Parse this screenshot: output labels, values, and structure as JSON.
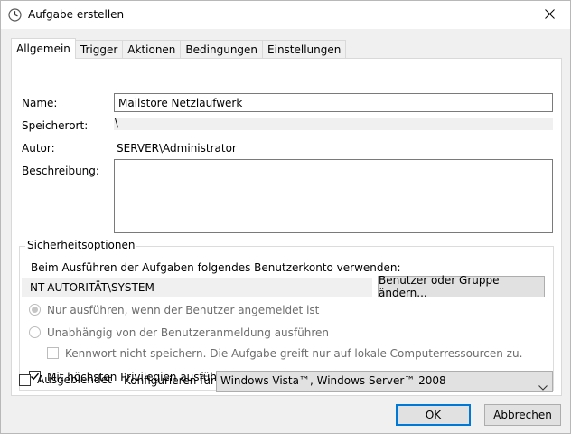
{
  "window": {
    "title": "Aufgabe erstellen"
  },
  "tabs": [
    {
      "label": "Allgemein",
      "active": true
    },
    {
      "label": "Trigger",
      "active": false
    },
    {
      "label": "Aktionen",
      "active": false
    },
    {
      "label": "Bedingungen",
      "active": false
    },
    {
      "label": "Einstellungen",
      "active": false
    }
  ],
  "general": {
    "name_label": "Name:",
    "name_value": "Mailstore Netzlaufwerk",
    "location_label": "Speicherort:",
    "location_value": "\\",
    "author_label": "Autor:",
    "author_value": "SERVER\\Administrator",
    "description_label": "Beschreibung:",
    "description_value": ""
  },
  "security": {
    "group_title": "Sicherheitsoptionen",
    "account_prompt": "Beim Ausführen der Aufgaben folgendes Benutzerkonto verwenden:",
    "account_value": "NT-AUTORITÄT\\SYSTEM",
    "change_button": "Benutzer oder Gruppe ändern...",
    "radio_logged_on": "Nur ausführen, wenn der Benutzer angemeldet ist",
    "radio_independent": "Unabhängig von der Benutzeranmeldung ausführen",
    "no_store_password": "Kennwort nicht speichern. Die Aufgabe greift nur auf lokale Computerressourcen zu.",
    "highest_privileges": "Mit höchsten Privilegien ausführen"
  },
  "footer": {
    "hidden_label": "Ausgeblendet",
    "configure_label": "Konfigurieren für:",
    "configure_value": "Windows Vista™, Windows Server™ 2008",
    "ok_button": "OK",
    "cancel_button": "Abbrechen"
  }
}
